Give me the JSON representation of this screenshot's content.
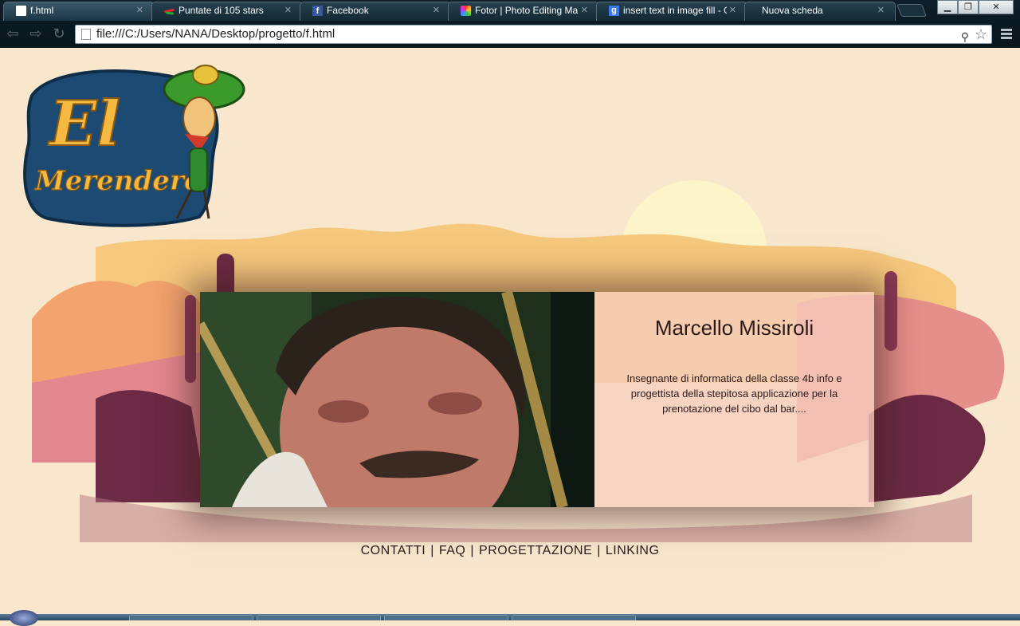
{
  "browser": {
    "tabs": [
      {
        "label": "f.html",
        "icon": "document-icon",
        "active": true
      },
      {
        "label": "Puntate di 105 stars",
        "icon": "stars-icon"
      },
      {
        "label": "Facebook",
        "icon": "facebook-icon"
      },
      {
        "label": "Fotor | Photo Editing Ma",
        "icon": "fotor-icon"
      },
      {
        "label": "insert text in image fill - G",
        "icon": "google-icon"
      },
      {
        "label": "Nuova scheda",
        "icon": ""
      }
    ],
    "url": "file:///C:/Users/NANA/Desktop/progetto/f.html"
  },
  "page": {
    "logo": {
      "line1": "El",
      "line2": "Merendero"
    },
    "profile": {
      "name": "Marcello Missiroli",
      "bio": "Insegnante di informatica della classe 4b info e progettista della stepitosa applicazione per la prenotazione del cibo dal bar...."
    },
    "footer": {
      "links": [
        "CONTATTI",
        "FAQ",
        "PROGETTAZIONE",
        "LINKING"
      ],
      "separator": "|"
    }
  },
  "colors": {
    "page_bg": "#f8e6cd",
    "logo_blue": "#1d4a72",
    "logo_yellow": "#f5b942",
    "sun": "#fdf5c9",
    "hills_pink": "#d9788a",
    "hills_maroon": "#6c2a44"
  }
}
